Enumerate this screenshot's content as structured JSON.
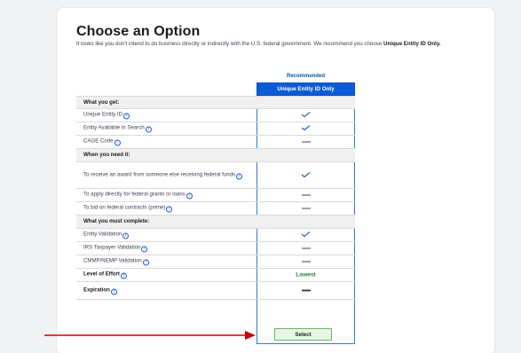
{
  "page": {
    "title": "Choose an Option",
    "intro_text": "It looks like you don't intend to do business directly or indirectly with the U.S. federal government. We recommend you choose",
    "intro_bold": "Unique Entity ID Only."
  },
  "column": {
    "recommended_label": "Recommended",
    "header": "Unique Entity ID Only",
    "select_label": "Select"
  },
  "rows": [
    {
      "label": "What you get:",
      "type": "section"
    },
    {
      "label": "Unique Entity ID",
      "info": true,
      "value": "check"
    },
    {
      "label": "Entity Available in Search",
      "info": true,
      "value": "check"
    },
    {
      "label": "CAGE Code",
      "info": true,
      "value": "dash"
    },
    {
      "label": "When you need it:",
      "type": "section"
    },
    {
      "label": "To receive an award from someone else receiving federal funds",
      "info": true,
      "value": "check",
      "tall": true
    },
    {
      "label": "To apply directly for federal grants or loans",
      "info": true,
      "value": "dash"
    },
    {
      "label": "To bid on federal contracts (prime)",
      "info": true,
      "value": "dash"
    },
    {
      "label": "What you must complete:",
      "type": "section"
    },
    {
      "label": "Entity Validation",
      "info": true,
      "value": "check"
    },
    {
      "label": "IRS Taxpayer Validation",
      "info": true,
      "value": "dash"
    },
    {
      "label": "CMMP/NEMP Validation",
      "info": true,
      "value": "dash"
    },
    {
      "label": "Level of Effort",
      "info": true,
      "value": "Lowest",
      "bold": true
    },
    {
      "label": "Expiration",
      "info": true,
      "value": "dash",
      "bold": true,
      "last": true
    }
  ],
  "colors": {
    "header_blue": "#0b5bd6",
    "column_border": "#2c79e0",
    "select_green": "#e8f6e6",
    "arrow_red": "#d10000"
  }
}
